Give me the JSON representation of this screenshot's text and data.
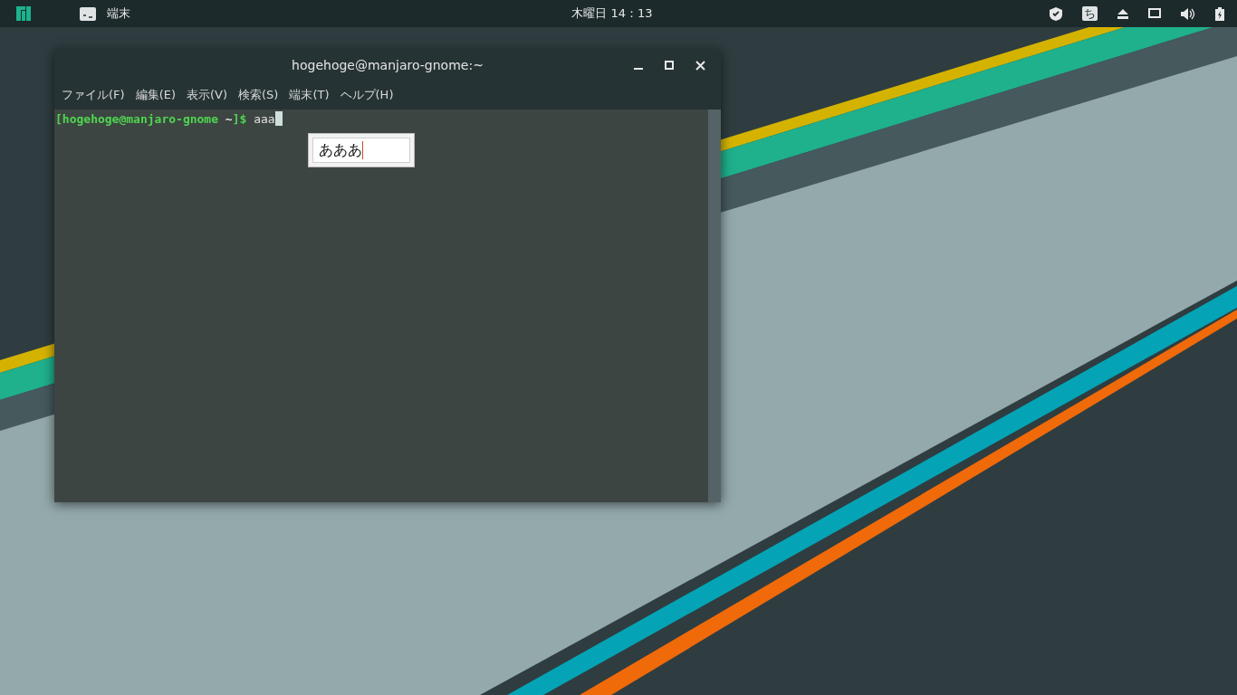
{
  "top_bar": {
    "app_name": "端末",
    "clock": "木曜日 14：13",
    "input_method": "ち"
  },
  "terminal": {
    "title": "hogehoge@manjaro-gnome:~",
    "menu": [
      "ファイル(F)",
      "編集(E)",
      "表示(V)",
      "検索(S)",
      "端末(T)",
      "ヘルプ(H)"
    ],
    "prompt": [
      {
        "text": "[hogehoge@manjaro-gnome",
        "color": "#4fd64f"
      },
      {
        "text": " ~",
        "color": "#e6e6e6"
      },
      {
        "text": "]$",
        "color": "#4fd64f"
      }
    ],
    "command": "aaa"
  },
  "ime_popup": {
    "preedit": "あああ"
  }
}
